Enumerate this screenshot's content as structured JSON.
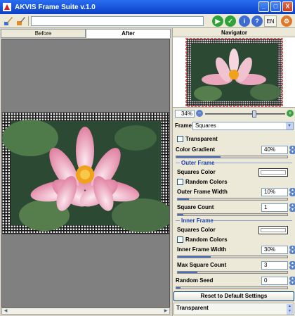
{
  "window": {
    "title": "AKVIS Frame Suite v.1.0",
    "minimize": "_",
    "maximize": "□",
    "close": "X"
  },
  "toolbar": {
    "language": "EN"
  },
  "tabs": {
    "before": "Before",
    "after": "After"
  },
  "navigator": {
    "title": "Navigator",
    "zoom": "34%",
    "zoom_level": 0.62
  },
  "frame": {
    "label": "Frame",
    "selected": "Squares"
  },
  "params": {
    "transparent_label": "Transparent",
    "color_gradient_label": "Color Gradient",
    "color_gradient_value": "40%",
    "color_gradient_level": 0.4,
    "outer_frame": {
      "title": "Outer Frame",
      "squares_color_label": "Squares Color",
      "random_colors_label": "Random Colors",
      "width_label": "Outer Frame Width",
      "width_value": "10%",
      "width_level": 0.1,
      "square_count_label": "Square Count",
      "square_count_value": "1",
      "square_count_level": 0.05
    },
    "inner_frame": {
      "title": "Inner Frame",
      "squares_color_label": "Squares Color",
      "random_colors_label": "Random Colors",
      "width_label": "Inner Frame Width",
      "width_value": "30%",
      "width_level": 0.3,
      "max_square_count_label": "Max Square Count",
      "max_square_count_value": "3",
      "max_square_count_level": 0.18
    },
    "random_seed_label": "Random Seed",
    "random_seed_value": "0",
    "random_seed_level": 0.0
  },
  "reset_label": "Reset to Default Settings",
  "hint": "Transparent",
  "colors": {
    "title_bar": "#0a3fc8",
    "accent_blue": "#1a3ea8",
    "canvas_gray": "#808080"
  }
}
